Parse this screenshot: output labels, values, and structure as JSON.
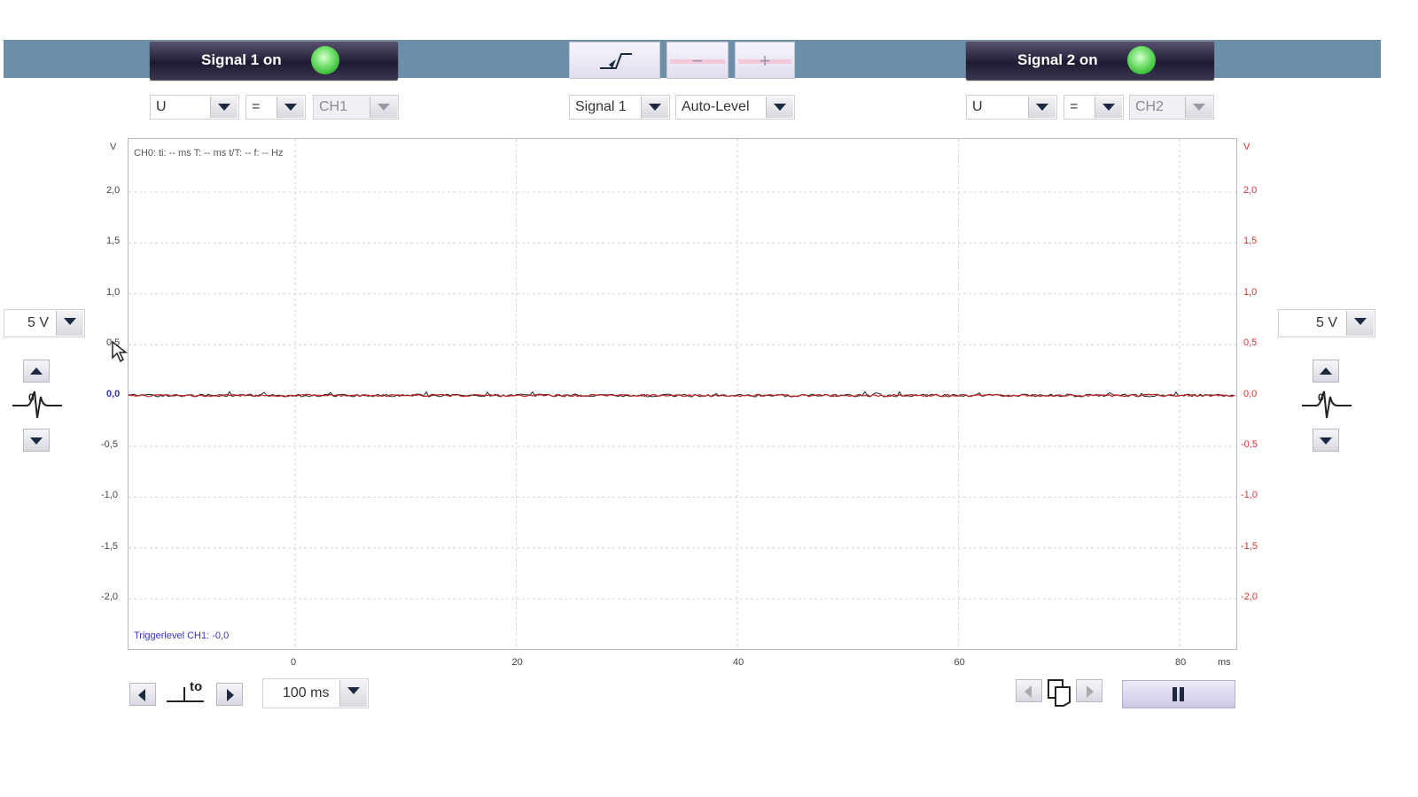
{
  "signal1": {
    "label": "Signal 1 on"
  },
  "signal2": {
    "label": "Signal 2 on"
  },
  "ch1_controls": {
    "quantity": "U",
    "coupling": "=",
    "channel": "CH1"
  },
  "ch2_controls": {
    "quantity": "U",
    "coupling": "=",
    "channel": "CH2"
  },
  "trigger": {
    "source": "Signal 1",
    "mode": "Auto-Level",
    "minus_label": "−",
    "plus_label": "+"
  },
  "left_range": "5 V",
  "right_range": "5 V",
  "plot": {
    "info_text": "CH0: ti: -- ms  T: -- ms  t/T: --  f: -- Hz",
    "trigger_text": "Triggerlevel CH1: -0,0",
    "left_unit": "V",
    "right_unit": "V",
    "x_unit": "ms",
    "y_ticks": [
      "2,0",
      "1,5",
      "1,0",
      "0,5",
      "0,0",
      "-0,5",
      "-1,0",
      "-1,5",
      "-2,0"
    ],
    "x_ticks": [
      "0",
      "20",
      "40",
      "60",
      "80"
    ]
  },
  "timebase": "100 ms",
  "t0_label": "to",
  "colors": {
    "bar": "#6b8fa8",
    "signal": "#c02020",
    "right_axis": "#e03030"
  }
}
